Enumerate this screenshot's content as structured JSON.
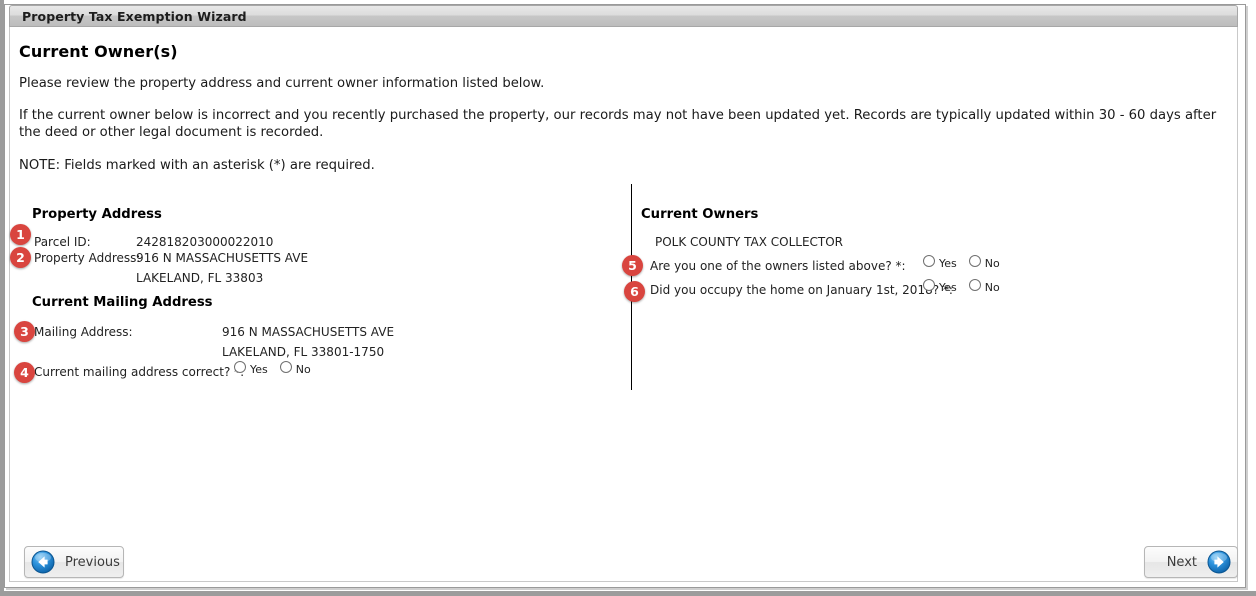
{
  "window": {
    "title": "Property Tax Exemption Wizard"
  },
  "page": {
    "title": "Current Owner(s)",
    "intro_1": "Please review the property address and current owner information listed below.",
    "intro_2": "If the current owner below is incorrect and you recently purchased the property, our records may not have been updated yet. Records are typically updated within 30 - 60 days after the deed or other legal document is recorded.",
    "intro_3": "NOTE: Fields marked with an asterisk (*) are required."
  },
  "property_address": {
    "heading": "Property Address",
    "parcel_id_label": "Parcel ID:",
    "parcel_id_value": "242818203000022010",
    "address_label": "Property Address:",
    "address_line_1": "916 N MASSACHUSETTS AVE",
    "address_line_2": "LAKELAND, FL 33803"
  },
  "mailing_address": {
    "heading": "Current Mailing Address",
    "address_label": "Mailing Address:",
    "address_line_1": "916 N MASSACHUSETTS AVE",
    "address_line_2": "LAKELAND, FL 33801-1750",
    "question_label": "Current mailing address correct? *:",
    "yes_label": "Yes",
    "no_label": "No"
  },
  "current_owners": {
    "heading": "Current Owners",
    "owner_name": "POLK COUNTY TAX COLLECTOR",
    "owner_question_label": "Are you one of the owners listed above? *:",
    "owner_yes_label": "Yes",
    "owner_no_label": "No",
    "occupy_question_label": "Did you occupy the home on January 1st, 2018? *:",
    "occupy_yes_label": "Yes",
    "occupy_no_label": "No"
  },
  "footer": {
    "previous_label": "Previous",
    "next_label": "Next"
  },
  "badges": {
    "b1": "1",
    "b2": "2",
    "b3": "3",
    "b4": "4",
    "b5": "5",
    "b6": "6",
    "color": "#d9453f"
  },
  "colors": {
    "titlebar_top": "#e8e8e8",
    "titlebar_bottom": "#bdbdbd",
    "frame_border": "#9a9a9a",
    "badge_red": "#d9453f",
    "arrow_blue": "#1e86d8",
    "text": "#1a1a1a"
  }
}
